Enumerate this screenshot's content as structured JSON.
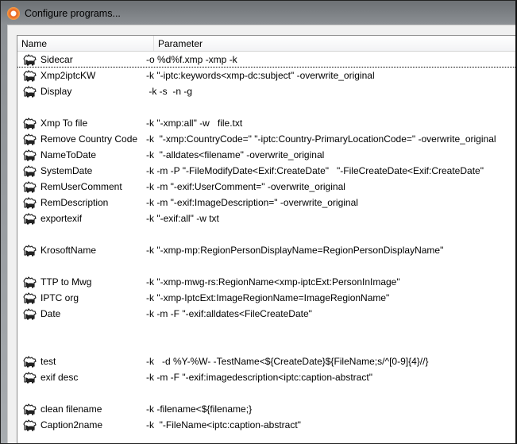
{
  "window": {
    "title": "Configure programs..."
  },
  "columns": {
    "name": "Name",
    "parameter": "Parameter"
  },
  "rows": [
    {
      "name": "Sidecar",
      "parameter": "-o %d%f.xmp -xmp -k"
    },
    {
      "name": "Xmp2iptcKW",
      "parameter": "-k \"-iptc:keywords<xmp-dc:subject\" -overwrite_original"
    },
    {
      "name": "Display",
      "parameter": " -k -s  -n -g"
    },
    {
      "name": "",
      "parameter": ""
    },
    {
      "name": "Xmp To file",
      "parameter": "-k \"-xmp:all\" -w   file.txt"
    },
    {
      "name": "Remove Country Code",
      "parameter": "-k  \"-xmp:CountryCode=\" \"-iptc:Country-PrimaryLocationCode=\" -overwrite_original"
    },
    {
      "name": "NameToDate",
      "parameter": "-k  \"-alldates<filename\" -overwrite_original"
    },
    {
      "name": "SystemDate",
      "parameter": "-k -m -P \"-FileModifyDate<Exif:CreateDate\"   \"-FileCreateDate<Exif:CreateDate\""
    },
    {
      "name": "RemUserComment",
      "parameter": "-k -m \"-exif:UserComment=\" -overwrite_original"
    },
    {
      "name": "RemDescription",
      "parameter": "-k -m \"-exif:ImageDescription=\" -overwrite_original"
    },
    {
      "name": "exportexif",
      "parameter": "-k \"-exif:all\" -w txt"
    },
    {
      "name": "",
      "parameter": ""
    },
    {
      "name": "KrosoftName",
      "parameter": "-k \"-xmp-mp:RegionPersonDisplayName=RegionPersonDisplayName\""
    },
    {
      "name": "",
      "parameter": ""
    },
    {
      "name": "TTP to Mwg",
      "parameter": "-k \"-xmp-mwg-rs:RegionName<xmp-iptcExt:PersonInImage\""
    },
    {
      "name": "IPTC org",
      "parameter": "-k \"-xmp-IptcExt:ImageRegionName=ImageRegionName\""
    },
    {
      "name": "Date",
      "parameter": "-k -m -F \"-exif:alldates<FileCreateDate\""
    },
    {
      "name": "",
      "parameter": ""
    },
    {
      "name": "",
      "parameter": ""
    },
    {
      "name": "test",
      "parameter": "-k   -d %Y-%W- -TestName<${CreateDate}${FileName;s/^[0-9]{4}//}"
    },
    {
      "name": "exif desc",
      "parameter": "-k -m -F \"-exif:imagedescription<iptc:caption-abstract\""
    },
    {
      "name": "",
      "parameter": ""
    },
    {
      "name": "clean filename",
      "parameter": "-k -filename<${filename;}"
    },
    {
      "name": "Caption2name",
      "parameter": "-k  \"-FileName<iptc:caption-abstract\""
    }
  ]
}
